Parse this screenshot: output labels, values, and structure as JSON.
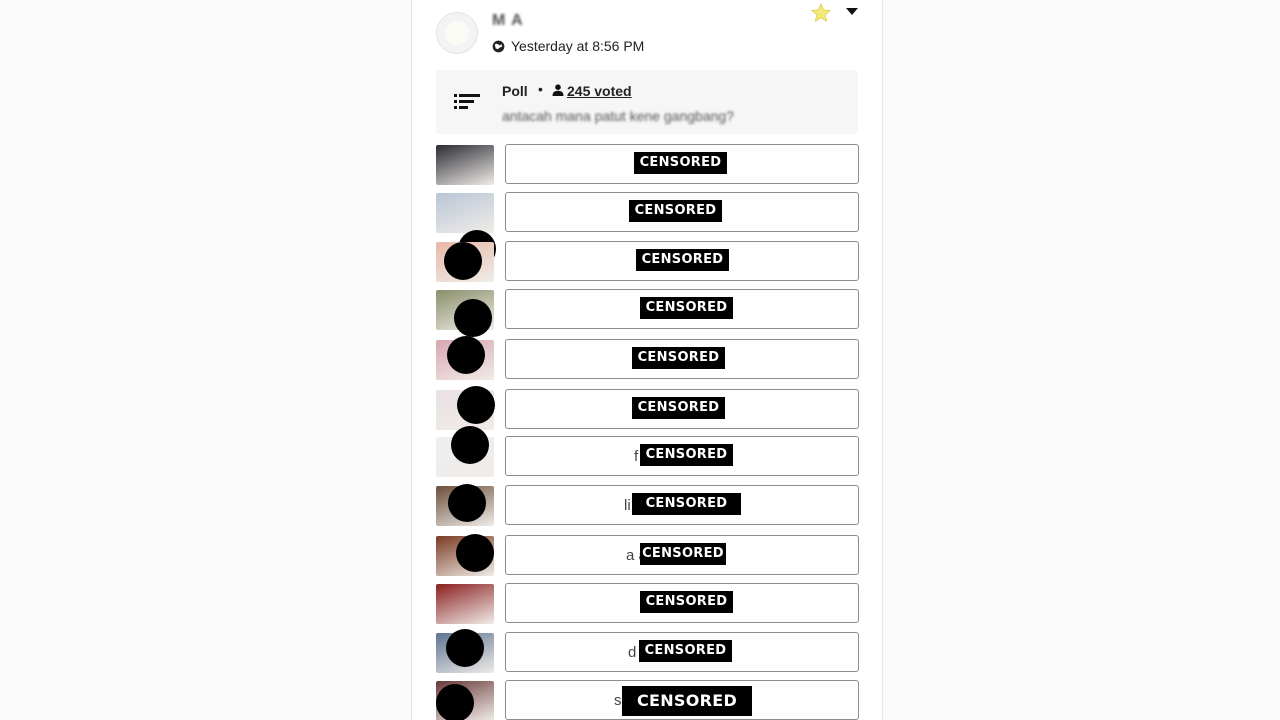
{
  "post": {
    "author": "M A",
    "timestamp": "Yesterday at 8:56 PM",
    "icons": [
      "globe-icon",
      "star-icon",
      "caret-down-icon"
    ]
  },
  "poll": {
    "label": "Poll",
    "separator": "•",
    "votes": "245 voted",
    "question": "antacah mana patut kene gangbang?",
    "icons": [
      "poll-list-icon",
      "user-icon"
    ]
  },
  "censor_label": "CENSORED",
  "options": [
    {
      "visible_text": "",
      "thumb_color": "#2b2b33"
    },
    {
      "visible_text": "",
      "thumb_color": "#b9c6d6"
    },
    {
      "visible_text": "",
      "thumb_color": "#e7b9a8"
    },
    {
      "visible_text": "",
      "thumb_color": "#8a8f6a"
    },
    {
      "visible_text": "",
      "thumb_color": "#d8a6b0"
    },
    {
      "visible_text": "",
      "thumb_color": "#e9e0e2"
    },
    {
      "visible_text": "f",
      "thumb_color": "#eeeef0"
    },
    {
      "visible_text": "li",
      "thumb_color": "#6b4f3a"
    },
    {
      "visible_text": "a                at",
      "thumb_color": "#7a3a22"
    },
    {
      "visible_text": "",
      "thumb_color": "#8a1f1f"
    },
    {
      "visible_text": "d",
      "thumb_color": "#5d7392"
    },
    {
      "visible_text": "s",
      "thumb_color": "#6a3a3a"
    }
  ]
}
